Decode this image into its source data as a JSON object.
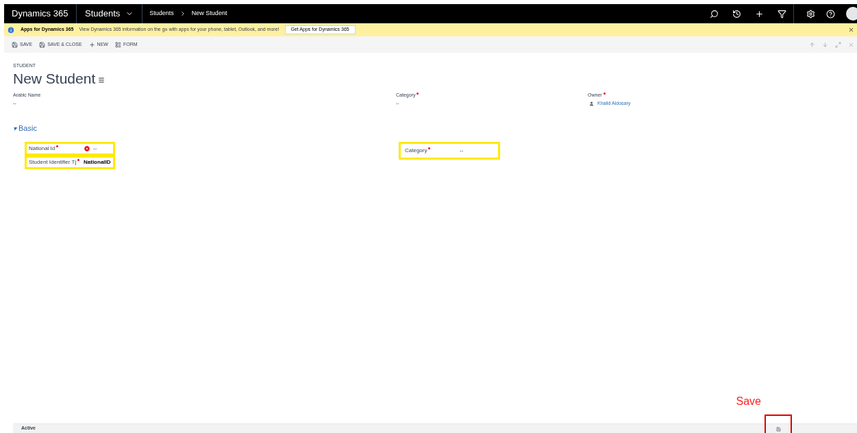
{
  "nav": {
    "app": "Dynamics 365",
    "area": "Students",
    "breadcrumb": [
      "Students",
      "New Student"
    ]
  },
  "notification": {
    "title": "Apps for Dynamics 365",
    "message": "View Dynamics 365 information on the go with apps for your phone, tablet, Outlook, and more!",
    "button": "Get Apps for Dynamics 365"
  },
  "commands": [
    {
      "label": "SAVE",
      "kind": "save"
    },
    {
      "label": "SAVE & CLOSE",
      "kind": "saveclose"
    },
    {
      "label": "NEW",
      "kind": "new"
    },
    {
      "label": "FORM",
      "kind": "form"
    }
  ],
  "record": {
    "entity": "STUDENT",
    "title": "New Student"
  },
  "header_fields": [
    {
      "label": "Arabic Name",
      "value": "--",
      "required": false,
      "kind": "text"
    },
    {
      "label": "Category",
      "value": "--",
      "required": true,
      "kind": "text"
    },
    {
      "label": "Owner",
      "value": "Khalid Aldosary",
      "required": true,
      "kind": "user"
    }
  ],
  "section": {
    "title": "Basic",
    "expanded": true
  },
  "left_fields": [
    {
      "label": "National Id",
      "value": "--",
      "required": true,
      "error": true,
      "bold": false
    },
    {
      "label": "Student Identifier Tj",
      "value": "NationalID",
      "required": true,
      "error": false,
      "bold": true
    }
  ],
  "right_fields": [
    {
      "label": "Category",
      "value": "--",
      "required": true,
      "error": false,
      "bold": false
    }
  ],
  "annotation": {
    "label": "Save"
  },
  "status_bar": {
    "status": "Active"
  }
}
